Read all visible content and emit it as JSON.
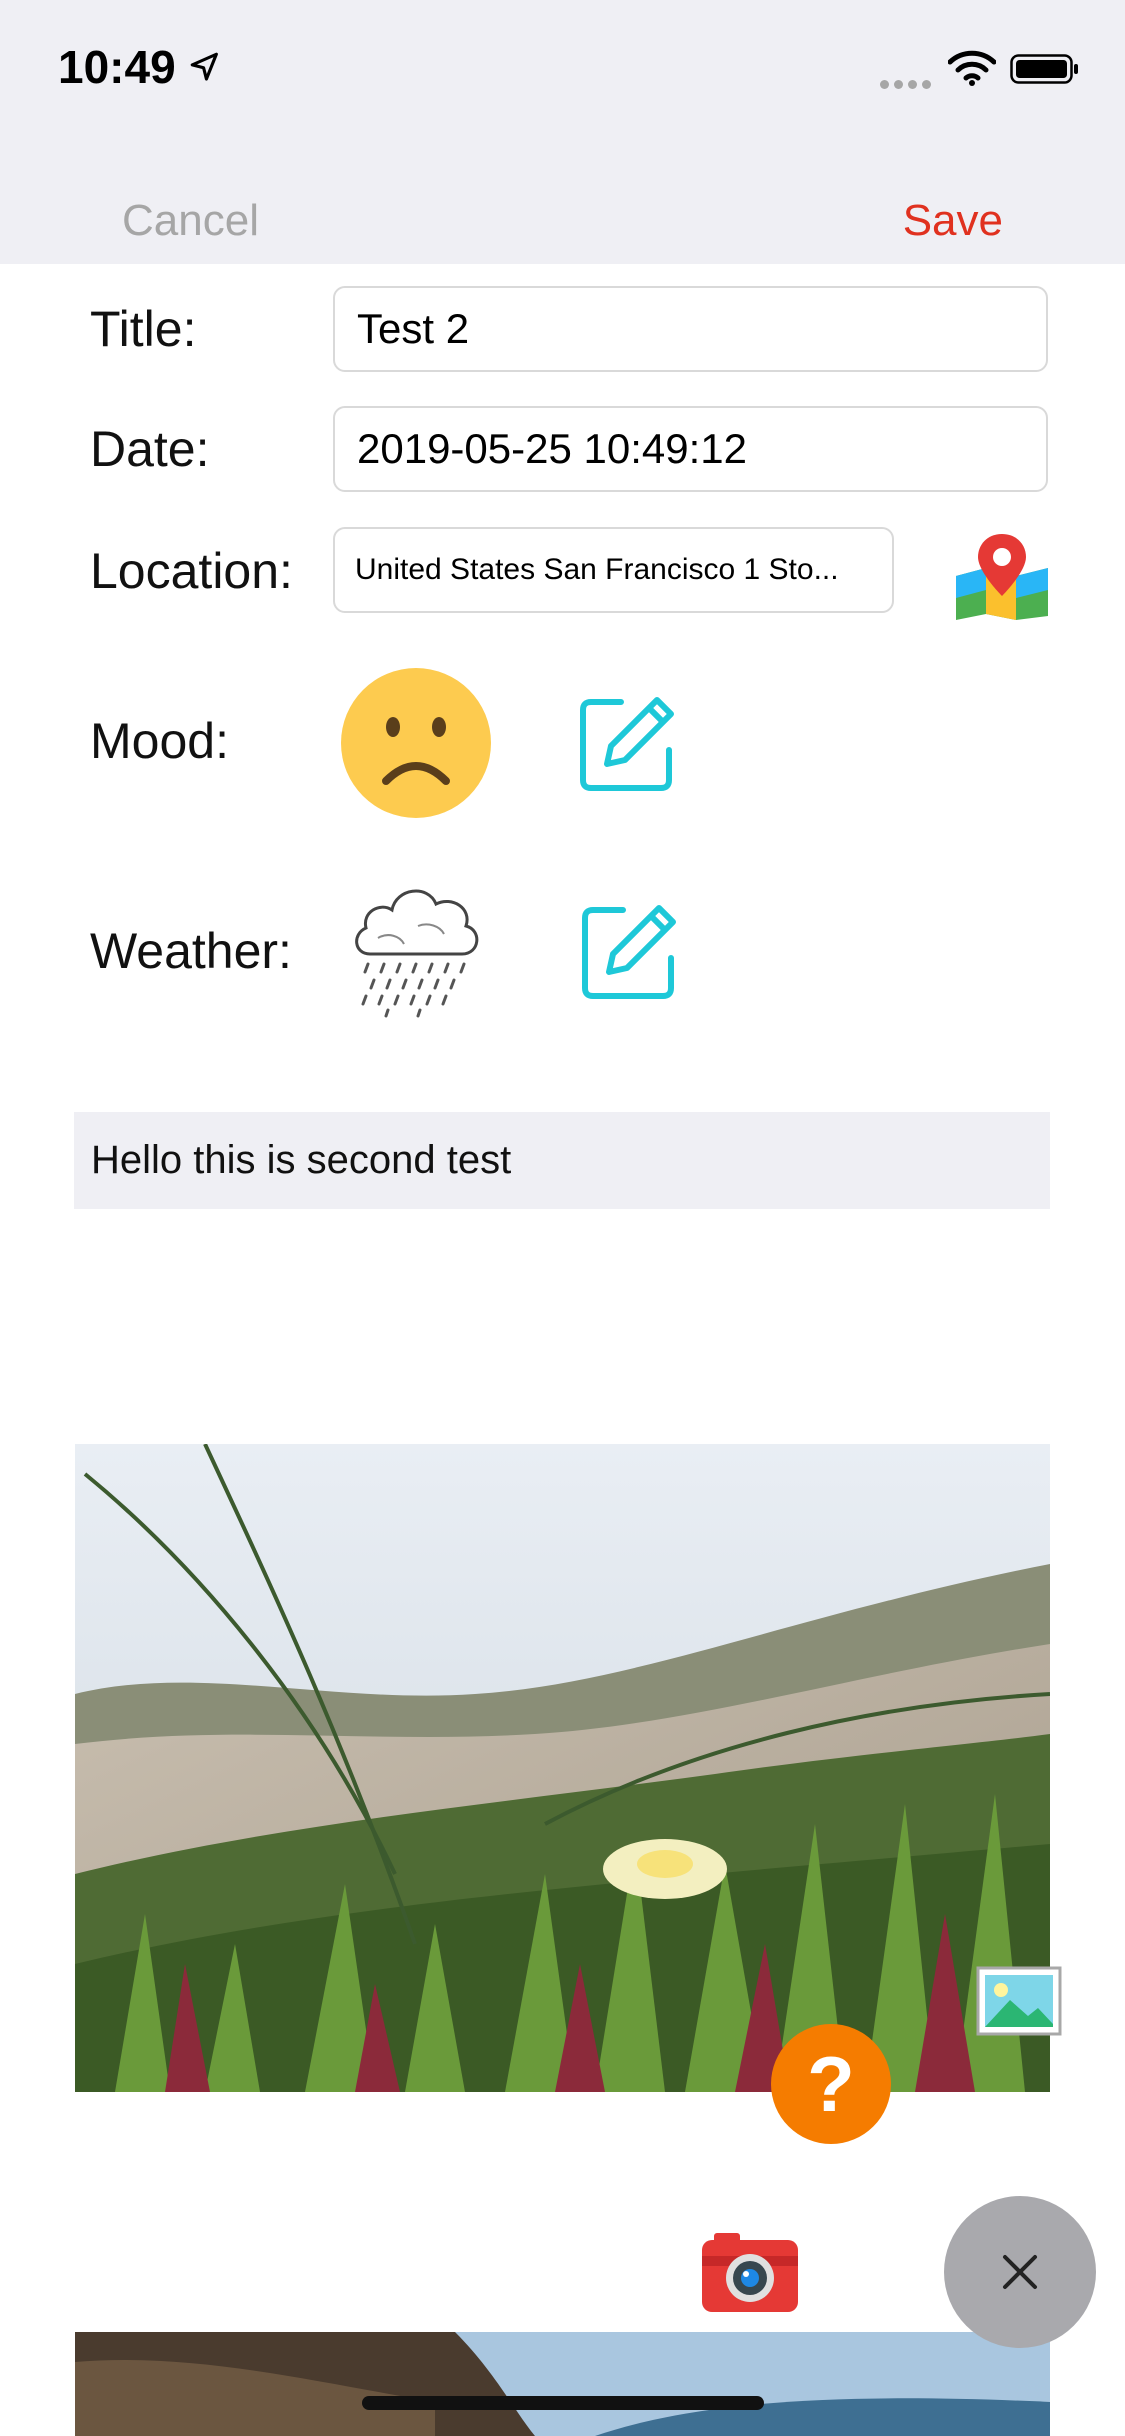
{
  "status_bar": {
    "time": "10:49"
  },
  "nav": {
    "cancel_label": "Cancel",
    "save_label": "Save"
  },
  "form": {
    "title_label": "Title:",
    "title_value": "Test 2",
    "date_label": "Date:",
    "date_value": "2019-05-25  10:49:12",
    "location_label": "Location:",
    "location_value": "United States San Francisco 1 Sto...",
    "mood_label": "Mood:",
    "weather_label": "Weather:"
  },
  "note": {
    "text": "Hello this is second test"
  },
  "icons": {
    "map": "map-pin-icon",
    "mood": "sad-face-icon",
    "weather": "rain-cloud-icon",
    "edit": "edit-pencil-icon",
    "picture": "picture-icon",
    "help": "question-icon",
    "camera": "camera-icon",
    "close": "close-icon"
  },
  "colors": {
    "accent_red": "#e0311f",
    "teal": "#1ec8d8",
    "orange": "#f57c00",
    "nav_background": "#efeff4"
  }
}
